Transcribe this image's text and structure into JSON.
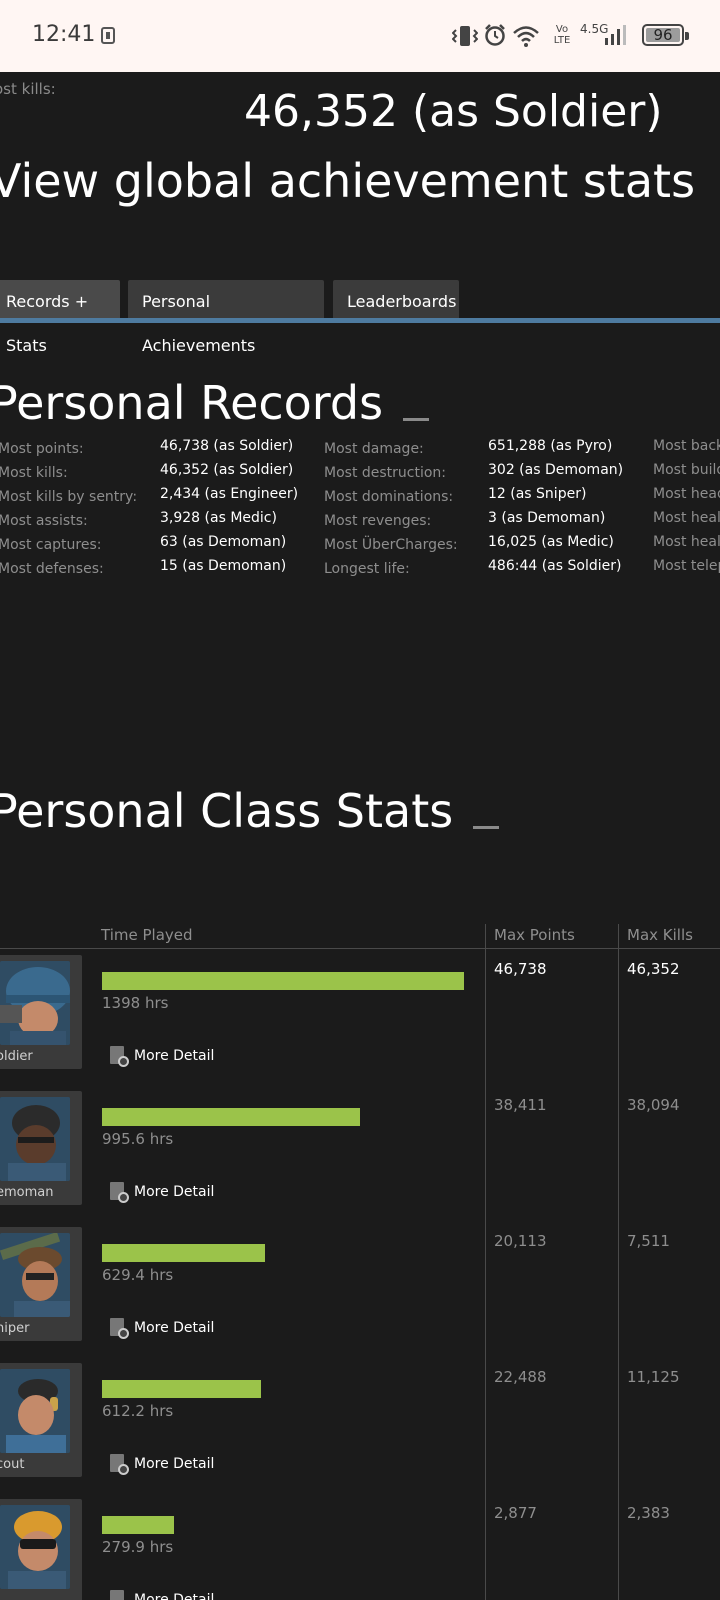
{
  "status_bar": {
    "time": "12:41",
    "network": "4.5G",
    "volte": "Vo LTE",
    "battery": "96",
    "icons": [
      "screenshot-icon",
      "vibrate-icon",
      "alarm-icon",
      "wifi-icon",
      "signal-icon",
      "battery-icon"
    ]
  },
  "top": {
    "label": "ost kills:",
    "value": "46,352 (as Soldier)",
    "view_link": "View global achievement stats"
  },
  "tabs": [
    {
      "label": "Records + Stats",
      "active": true
    },
    {
      "label": "Personal Achievements",
      "active": false
    },
    {
      "label": "Leaderboards",
      "active": false
    }
  ],
  "tab_underline_color": "#4e7ba0",
  "personal_records": {
    "title": "Personal Records",
    "col1": [
      {
        "label": "Most points:",
        "value": "46,738 (as Soldier)"
      },
      {
        "label": "Most kills:",
        "value": "46,352 (as Soldier)"
      },
      {
        "label": "Most kills by sentry:",
        "value": "2,434 (as Engineer)"
      },
      {
        "label": "Most assists:",
        "value": "3,928 (as Medic)"
      },
      {
        "label": "Most captures:",
        "value": "63 (as Demoman)"
      },
      {
        "label": "Most defenses:",
        "value": "15 (as Demoman)"
      }
    ],
    "col2": [
      {
        "label": "Most damage:",
        "value": "651,288 (as Pyro)"
      },
      {
        "label": "Most destruction:",
        "value": "302 (as Demoman)"
      },
      {
        "label": "Most dominations:",
        "value": "12 (as Sniper)"
      },
      {
        "label": "Most revenges:",
        "value": "3 (as Demoman)"
      },
      {
        "label": "Most ÜberCharges:",
        "value": "16,025 (as Medic)"
      },
      {
        "label": "Longest life:",
        "value": "486:44 (as Soldier)"
      }
    ],
    "col3": [
      "Most back",
      "Most build",
      "Most head",
      "Most heal",
      "Most heal",
      "Most telep"
    ]
  },
  "class_stats": {
    "title": "Personal Class Stats",
    "headers": {
      "time": "Time Played",
      "points": "Max Points",
      "kills": "Max Kills"
    },
    "bar_color": "#9bc34a",
    "more_detail": "More Detail",
    "rows": [
      {
        "cls": "oldier",
        "hours": "1398 hrs",
        "fraction": 1.0,
        "points": "46,738",
        "kills": "46,352",
        "highlight": true
      },
      {
        "cls": "emoman",
        "hours": "995.6 hrs",
        "fraction": 0.712,
        "points": "38,411",
        "kills": "38,094",
        "highlight": false
      },
      {
        "cls": "niper",
        "hours": "629.4 hrs",
        "fraction": 0.45,
        "points": "20,113",
        "kills": "7,511",
        "highlight": false
      },
      {
        "cls": "cout",
        "hours": "612.2 hrs",
        "fraction": 0.438,
        "points": "22,488",
        "kills": "11,125",
        "highlight": false
      },
      {
        "cls": "",
        "hours": "279.9 hrs",
        "fraction": 0.2,
        "points": "2,877",
        "kills": "2,383",
        "highlight": false
      }
    ]
  }
}
